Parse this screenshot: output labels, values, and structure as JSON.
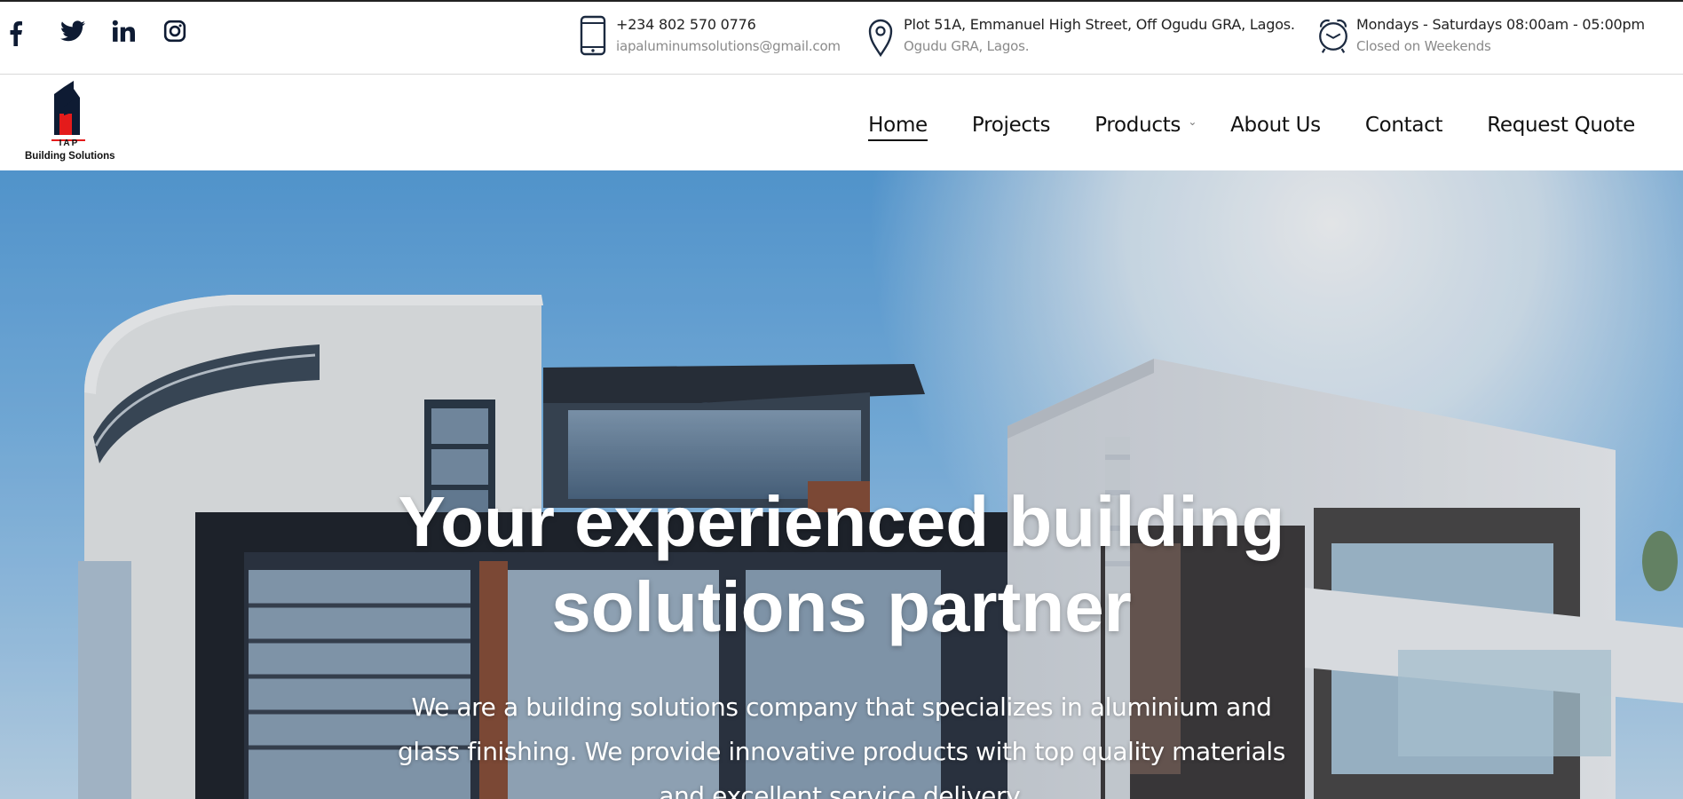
{
  "social": [
    {
      "name": "facebook-icon"
    },
    {
      "name": "twitter-icon"
    },
    {
      "name": "linkedin-icon"
    },
    {
      "name": "instagram-icon"
    }
  ],
  "contact": {
    "phone": "+234 802 570 0776",
    "email": "iapaluminumsolutions@gmail.com",
    "address_line1": "Plot 51A, Emmanuel High Street, Off Ogudu GRA, Lagos.",
    "address_line2": "Ogudu GRA, Lagos.",
    "hours_line1": "Mondays - Saturdays 08:00am - 05:00pm",
    "hours_line2": "Closed on Weekends"
  },
  "logo": {
    "mark_text": "IAP",
    "caption": "Building Solutions"
  },
  "nav": {
    "home": "Home",
    "projects": "Projects",
    "products": "Products",
    "about": "About Us",
    "contact": "Contact",
    "quote": "Request Quote"
  },
  "hero": {
    "title_line1": "Your experienced building",
    "title_line2": "solutions partner",
    "subtitle_line1": "We are a building solutions company that specializes in aluminium and",
    "subtitle_line2": "glass finishing. We provide innovative products with top quality materials",
    "subtitle_line3": "and excellent service delivery."
  },
  "colors": {
    "brand_navy": "#0e1b33",
    "brand_red": "#e41b1b",
    "sky": "#7db9ea"
  }
}
